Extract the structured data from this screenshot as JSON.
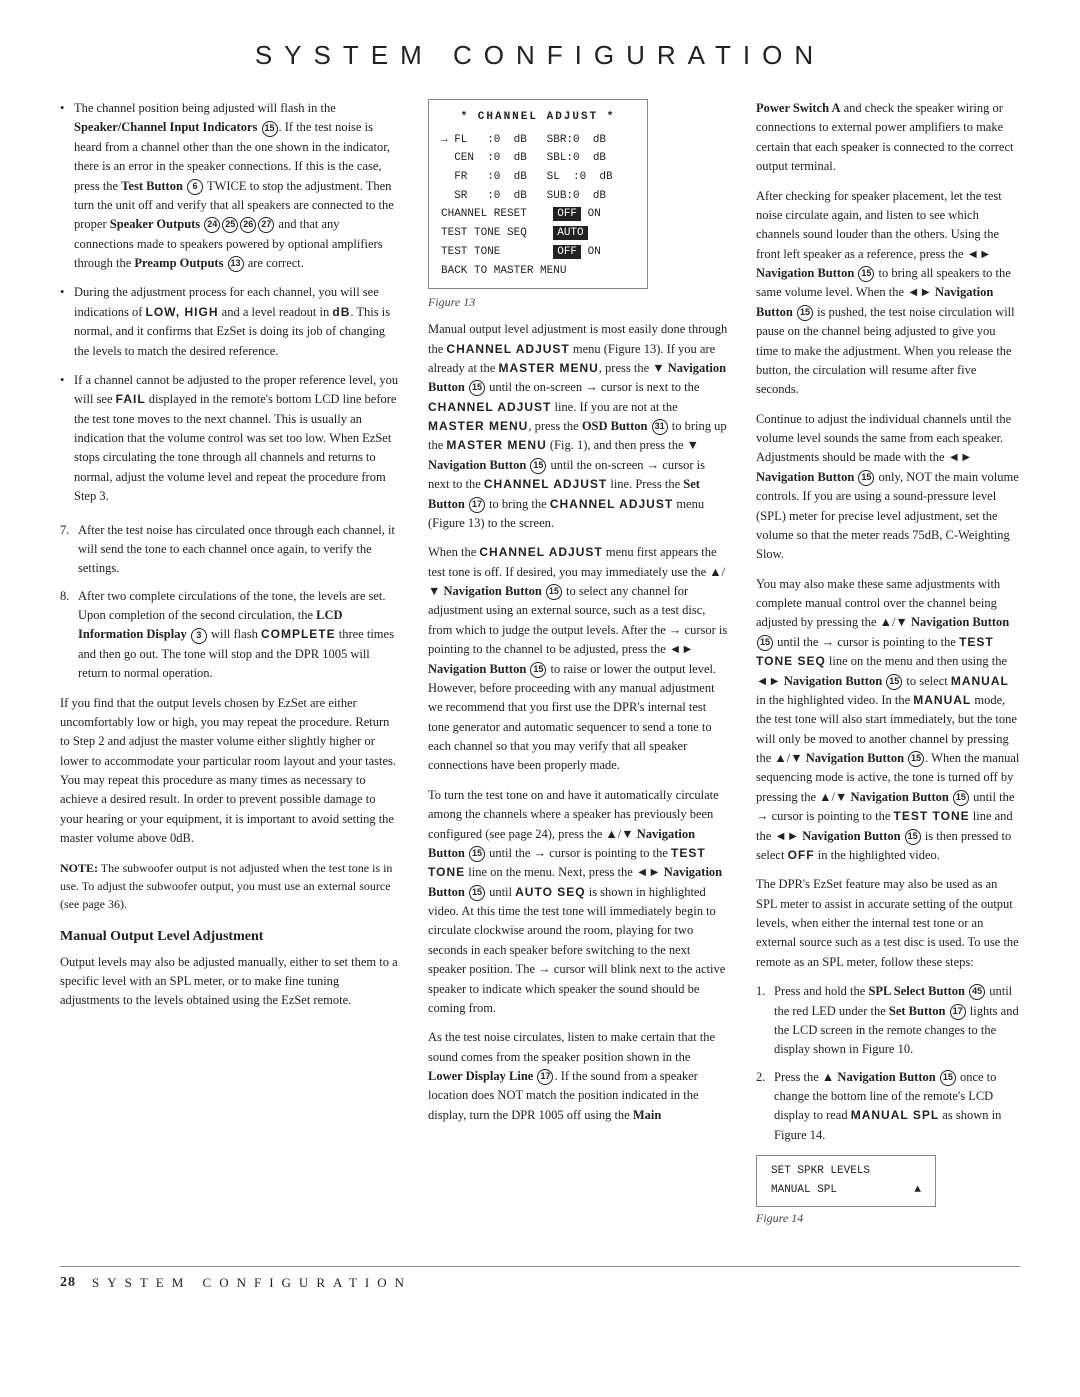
{
  "header": {
    "title": "SYSTEM CONFIGURATION"
  },
  "footer": {
    "page_number": "28",
    "title": "SYSTEM CONFIGURATION"
  },
  "left_column": {
    "bullets": [
      {
        "text": "The channel position being adjusted will flash in the Speaker/Channel Input Indicators",
        "indicator": "15",
        "continuation": ". If the test noise is heard from a channel other than the one shown in the indicator, there is an error in the speaker connections. If this is the case, press the Test Button",
        "btn6": "6",
        "continuation2": " TWICE to stop the adjustment. Then turn the unit off and verify that all speakers are connected to the proper Speaker Outputs",
        "badges": "24 25 26 27",
        "continuation3": " and that any connections made to speakers powered by optional amplifiers through the Preamp Outputs",
        "btn13": "13",
        "end": " are correct."
      },
      {
        "text": "During the adjustment process for each channel, you will see indications of LOW, HIGH and a level readout in dB. This is normal, and it confirms that EzSet is doing its job of changing the levels to match the desired reference."
      },
      {
        "text": "If a channel cannot be adjusted to the proper reference level, you will see FAIL displayed in the remote's bottom LCD line before the test tone moves to the next channel. This is usually an indication that the volume control was set too low. When EzSet stops circulating the tone through all channels and returns to normal, adjust the volume level and repeat the procedure from Step 3."
      }
    ],
    "numbered": [
      {
        "num": "7.",
        "text": "After the test noise has circulated once through each channel, it will send the tone to each channel once again, to verify the settings."
      },
      {
        "num": "8.",
        "text": "After two complete circulations of the tone, the levels are set. Upon completion of the second circulation, the LCD Information Display",
        "btn3": "3",
        "continuation": " will flash COMPLETE three times and then go out. The tone will stop and the DPR 1005 will return to normal operation."
      }
    ],
    "paragraph1": "If you find that the output levels chosen by EzSet are either uncomfortably low or high, you may repeat the procedure. Return to Step 2 and adjust the master volume either slightly higher or lower to accommodate your particular room layout and your tastes. You may repeat this procedure as many times as necessary to achieve a desired result. In order to prevent possible damage to your hearing or your equipment, it is important to avoid setting the master volume above 0dB.",
    "note": "NOTE: The subwoofer output is not adjusted when the test tone is in use. To adjust the subwoofer output, you must use an external source (see page 36).",
    "manual_heading": "Manual Output Level Adjustment",
    "manual_para": "Output levels may also be adjusted manually, either to set them to a specific level with an SPL meter, or to make fine tuning adjustments to the levels obtained using the EzSet remote."
  },
  "middle_column": {
    "channel_adjust": {
      "header": "* CHANNEL ADJUST *",
      "rows": [
        {
          "left": "→ FL   :0  dB",
          "right": "SBR:0  dB"
        },
        {
          "left": "  CEN  :0  dB",
          "right": "SBL:0  dB"
        },
        {
          "left": "  FR   :0  dB",
          "right": "SL :0  dB"
        },
        {
          "left": "  SR   :0  dB",
          "right": "SUB:0  dB"
        }
      ],
      "menu_rows": [
        "CHANNEL RESET",
        "TEST TONE SEQ",
        "TEST TONE",
        "BACK TO MASTER MENU"
      ],
      "off_label": "OFF",
      "on_label": "ON",
      "auto_label": "AUTO",
      "off2_label": "OFF"
    },
    "figure13": "Figure 13",
    "paragraph1": "Manual output level adjustment is most easily done through the CHANNEL ADJUST menu (Figure 13). If you are already at the MASTER MENU, press the ▼ Navigation Button",
    "btn15a": "15",
    "para1b": " until the on-screen → cursor is next to the CHANNEL ADJUST line. If you are not at the MASTER MENU, press the OSD Button",
    "btn31": "31",
    "para1c": " to bring up the MASTER MENU (Fig. 1), and then press the ▼ Navigation Button",
    "btn15b": "15",
    "para1d": " until the on-screen → cursor is next to the CHANNEL ADJUST line. Press the Set Button",
    "btn17": "17",
    "para1e": " to bring the CHANNEL ADJUST menu (Figure 13) to the screen.",
    "paragraph2": "When the CHANNEL ADJUST menu first appears the test tone is off. If desired, you may immediately use the ▲/▼ Navigation Button",
    "btn15c": "15",
    "para2b": " to select any channel for adjustment using an external source, such as a test disc, from which to judge the output levels. After the → cursor is pointing to the channel to be adjusted, press the ◄► Navigation Button",
    "btn15d": "15",
    "para2c": " to raise or lower the output level. However, before proceeding with any manual adjustment we recommend that you first use the DPR's internal test tone generator and automatic sequencer to send a tone to each channel so that you may verify that all speaker connections have been properly made.",
    "paragraph3": "To turn the test tone on and have it automatically circulate among the channels where a speaker has previously been configured (see page 24), press the ▲/▼ Navigation Button",
    "btn15e": "15",
    "para3b": " until the → cursor is pointing to the TEST TONE line on the menu. Next, press the ◄► Navigation Button",
    "btn15f": "15",
    "para3c": " until AUTO SEQ is shown in highlighted video. At this time the test tone will immediately begin to circulate clockwise around the room, playing for two seconds in each speaker before switching to the next speaker position. The → cursor will blink next to the active speaker to indicate which speaker the sound should be coming from.",
    "paragraph4": "As the test noise circulates, listen to make certain that the sound comes from the speaker position shown in the Lower Display Line",
    "btn17b": "17",
    "para4b": ". If the sound from a speaker location does NOT match the position indicated in the display, turn the DPR 1005 off using the Main"
  },
  "right_column": {
    "paragraph1": "Power Switch A and check the speaker wiring or connections to external power amplifiers to make certain that each speaker is connected to the correct output terminal.",
    "paragraph2": "After checking for speaker placement, let the test noise circulate again, and listen to see which channels sound louder than the others. Using the front left speaker as a reference, press the ◄► Navigation Button",
    "btn15g": "15",
    "para2b": " to bring all speakers to the same volume level. When the ◄► Navigation Button",
    "btn15h": "15",
    "para2c": " is pushed, the test noise circulation will pause on the channel being adjusted to give you time to make the adjustment. When you release the button, the circulation will resume after five seconds.",
    "paragraph3": "Continue to adjust the individual channels until the volume level sounds the same from each speaker. Adjustments should be made with the ◄► Navigation Button",
    "btn15i": "15",
    "para3b": " only, NOT the main volume controls. If you are using a sound-pressure level (SPL) meter for precise level adjustment, set the volume so that the meter reads 75dB, C-Weighting Slow.",
    "paragraph4": "You may also make these same adjustments with complete manual control over the channel being adjusted by pressing the ▲/▼ Navigation Button",
    "btn15j": "15",
    "para4b": " until the → cursor is pointing to the TEST TONE SEQ line on the menu and then using the ◄► Navigation Button",
    "btn15k": "15",
    "para4c": " to select MANUAL in the highlighted video. In the MANUAL mode, the test tone will also start immediately, but the tone will only be moved to another channel by pressing the ▲/▼ Navigation Button",
    "btn15l": "15",
    "para4d": ". When the manual sequencing mode is active, the tone is turned off by pressing the ▲/▼ Navigation Button",
    "btn15m": "15",
    "para4e": " until the → cursor is pointing to the TEST TONE line and the ◄► Navigation Button",
    "btn15n": "15",
    "para4f": " is then pressed to select OFF in the highlighted video.",
    "paragraph5": "The DPR's EzSet feature may also be used as an SPL meter to assist in accurate setting of the output levels, when either the internal test tone or an external source such as a test disc is used. To use the remote as an SPL meter, follow these steps:",
    "numbered": [
      {
        "num": "1.",
        "text": "Press and hold the SPL Select Button",
        "btn45": "45",
        "continuation": " until the red LED under the Set Button",
        "btn17c": "17",
        "end": " lights and the LCD screen in the remote changes to the display shown in Figure 10."
      },
      {
        "num": "2.",
        "text": "Press the ▲ Navigation Button",
        "btn15o": "15",
        "end": " once to change the bottom line of the remote's LCD display to read MANUAL SPL as shown in Figure 14."
      }
    ],
    "spl_display": {
      "line1": "SET SPKR LEVELS",
      "line2": "MANUAL SPL",
      "arrow": "▲"
    },
    "figure14": "Figure 14"
  }
}
